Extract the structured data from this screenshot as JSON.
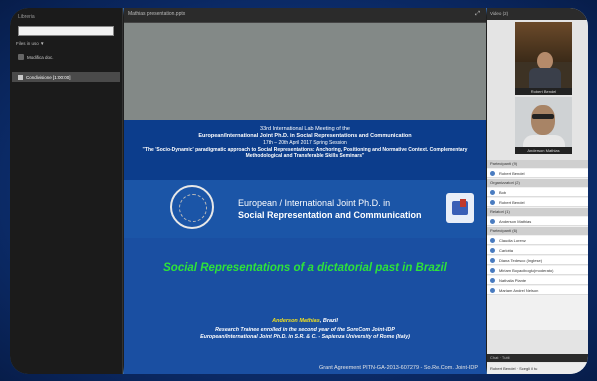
{
  "left_panel": {
    "title": "Libreria",
    "zoom": "Files in uso ▼",
    "files_label": "Modifica doc.",
    "item_label": "Condivisione [1:00:00]"
  },
  "presentation": {
    "window_title": "Mathias presentation.pptx",
    "control": "⤢",
    "slide": {
      "line1": "33rd International Lab Meeting of the",
      "line2": "European/International Joint Ph.D. in Social Representations and Communication",
      "line3": "17th – 20th April 2017 Spring Session",
      "line4": "\"The 'Socio-Dynamic' paradigmatic approach to Social Representations: Anchoring, Positioning and Normative Context. Complementary Methodological and Transferable Skills Seminars\"",
      "eu_line1": "European / International Joint Ph.D. in",
      "eu_line2": "Social Representation and Communication",
      "main_title": "Social Representations of a dictatorial past in Brazil",
      "author_name": "Anderson Mathias",
      "author_city": ", Brazil",
      "info_line1": "Research Trainee enrolled in the second year of the SoreCom Joint-IDP",
      "info_line2": "European/International Joint Ph.D. in S.R. & C. - Sapienza University of Rome (Italy)",
      "grant": "Grant Agreement PITN-GA-2013-607279 - So.Re.Com. Joint-IDP"
    }
  },
  "right_panel": {
    "video_title": "Video (2)",
    "video1_name": "Robert Bendel",
    "video2_name": "Anderson Mathias",
    "participants_header": "Partecipanti (9)",
    "host_row": "Robert Bendel",
    "hosts_header": "Organizzatori (2)",
    "hosts": [
      "Bob",
      "Robert Bendel"
    ],
    "presenters_header": "Relatori (1)",
    "presenters": [
      "Anderson Mathias"
    ],
    "attendees_header": "Partecipanti (6)",
    "attendees": [
      "Claudia Lorenz",
      "Carlotta",
      "Diana Tedesco (Inglese)",
      "Miriam Boyaciboglu(moderato)",
      "Nathalia Plante",
      "Mariam Andrel Nelson"
    ],
    "chat_header": "Chat · Tutti",
    "chat_row": "Robert Bendel · Scegli il tu"
  }
}
